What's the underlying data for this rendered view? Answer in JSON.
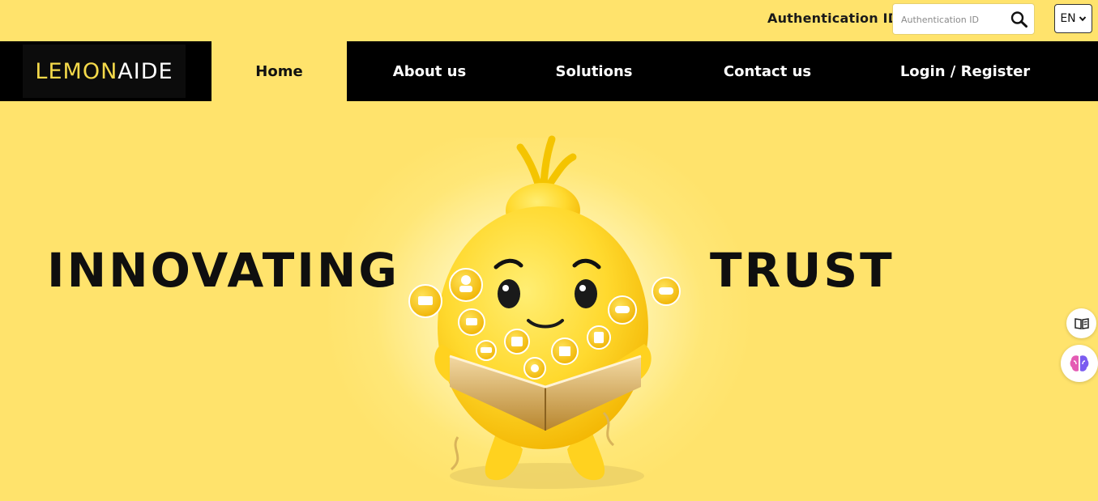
{
  "topbar": {
    "auth_label": "Authentication ID",
    "search_placeholder": "Authentication ID",
    "language": "EN"
  },
  "nav": {
    "logo_part1": "LEMON",
    "logo_part2": "AIDE",
    "items": [
      {
        "label": "Home",
        "active": true
      },
      {
        "label": "About us",
        "active": false
      },
      {
        "label": "Solutions",
        "active": false
      },
      {
        "label": "Contact us",
        "active": false
      },
      {
        "label": "Login / Register",
        "active": false
      }
    ]
  },
  "hero": {
    "word_left": "INNOVATING",
    "word_right": "TRUST"
  },
  "colors": {
    "background": "#ffe36c",
    "nav_background": "#000000",
    "logo_accent": "#f4d94a",
    "mascot_yellow": "#ffd83a"
  },
  "icons": [
    "search-icon",
    "chevron-down-icon",
    "book-icon",
    "brain-icon"
  ]
}
